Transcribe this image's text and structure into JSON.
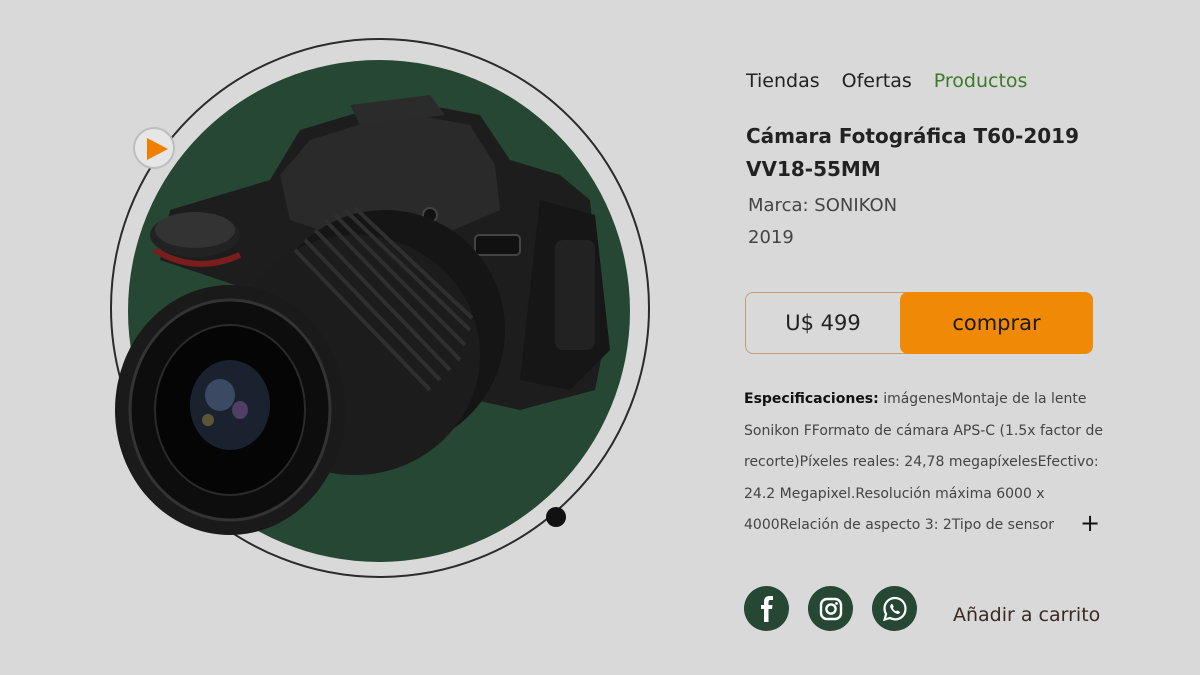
{
  "nav": {
    "items": [
      {
        "label": "Tiendas"
      },
      {
        "label": "Ofertas"
      },
      {
        "label": "Productos",
        "active": true
      }
    ]
  },
  "product": {
    "title": "Cámara Fotográfica T60-2019 VV18-55MM",
    "brand": "Marca: SONIKON",
    "year": "2019",
    "price": "U$ 499",
    "buy_label": "comprar",
    "specs_label": "Especificaciones:",
    "specs_text": " imágenesMontaje de la lente Sonikon FFormato de cámara APS-C (1.5x factor de recorte)Píxeles reales: 24,78 megapíxelesEfectivo: 24.2 Megapixel.Resolución máxima 6000 x 4000Relación de aspecto 3: 2Tipo de sensor",
    "expand_icon": "+"
  },
  "actions": {
    "add_to_cart": "Añadir a carrito"
  },
  "colors": {
    "accent_green": "#264733",
    "buy_orange": "#f08a06",
    "active_nav": "#3a7a2a",
    "background": "#d9d9d9"
  },
  "icons": {
    "play": "play-icon",
    "social": [
      "facebook-icon",
      "instagram-icon",
      "whatsapp-icon"
    ]
  }
}
